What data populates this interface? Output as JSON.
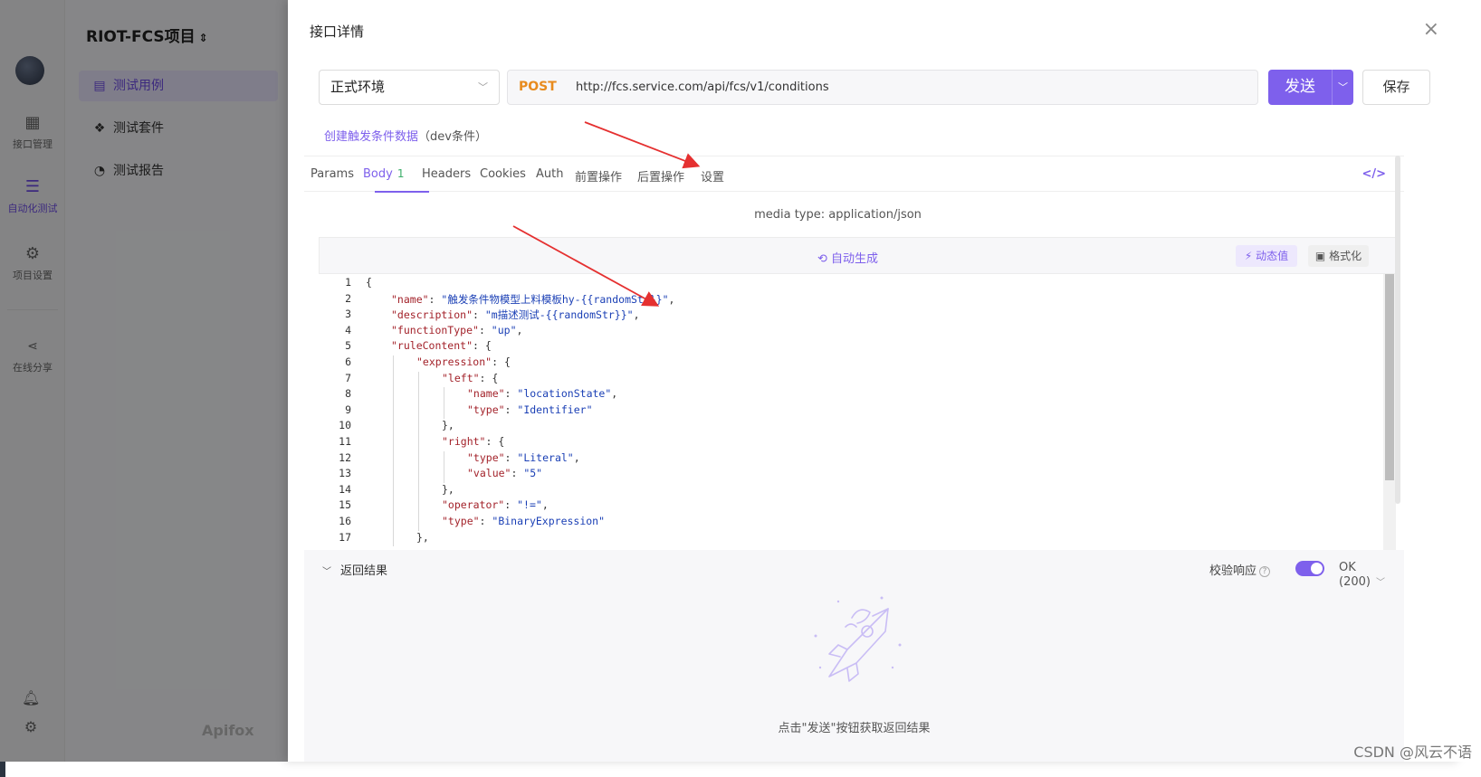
{
  "app": {
    "project_title": "RIOT-FCS项目",
    "rail": [
      {
        "label": "接口管理",
        "icon": "api-icon"
      },
      {
        "label": "自动化测试",
        "icon": "automation-icon"
      },
      {
        "label": "项目设置",
        "icon": "settings-icon"
      },
      {
        "label": "在线分享",
        "icon": "share-icon"
      }
    ],
    "menu": [
      {
        "label": "测试用例",
        "icon": "doc-icon"
      },
      {
        "label": "测试套件",
        "icon": "suite-icon"
      },
      {
        "label": "测试报告",
        "icon": "report-icon"
      }
    ],
    "brand": "Apifox"
  },
  "drawer": {
    "title": "接口详情",
    "close_glyph": "×",
    "environment": "正式环境",
    "method": "POST",
    "url": "http://fcs.service.com/api/fcs/v1/conditions",
    "send_label": "发送",
    "save_label": "保存",
    "api_name": "创建触发条件数据",
    "api_tag": "（dev条件）",
    "tabs": [
      {
        "label": "Params"
      },
      {
        "label": "Body",
        "badge": "1"
      },
      {
        "label": "Headers"
      },
      {
        "label": "Cookies"
      },
      {
        "label": "Auth"
      },
      {
        "label": "前置操作"
      },
      {
        "label": "后置操作"
      },
      {
        "label": "设置"
      }
    ],
    "code_icon": "</>",
    "media_type": "media type: application/json",
    "auto_generate": "自动生成",
    "dynamic_value": "动态值",
    "format": "格式化",
    "code_lines": [
      {
        "n": "1",
        "indent": 0,
        "parts": [
          [
            "p",
            "{"
          ]
        ]
      },
      {
        "n": "2",
        "indent": 1,
        "parts": [
          [
            "k",
            "\"name\""
          ],
          [
            "p",
            ": "
          ],
          [
            "s",
            "\"触发条件物模型上料模板hy-{{randomStr}}\""
          ],
          [
            "p",
            ","
          ]
        ]
      },
      {
        "n": "3",
        "indent": 1,
        "parts": [
          [
            "k",
            "\"description\""
          ],
          [
            "p",
            ": "
          ],
          [
            "s",
            "\"m描述测试-{{randomStr}}\""
          ],
          [
            "p",
            ","
          ]
        ]
      },
      {
        "n": "4",
        "indent": 1,
        "parts": [
          [
            "k",
            "\"functionType\""
          ],
          [
            "p",
            ": "
          ],
          [
            "s",
            "\"up\""
          ],
          [
            "p",
            ","
          ]
        ]
      },
      {
        "n": "5",
        "indent": 1,
        "parts": [
          [
            "k",
            "\"ruleContent\""
          ],
          [
            "p",
            ": {"
          ]
        ]
      },
      {
        "n": "6",
        "indent": 2,
        "parts": [
          [
            "k",
            "\"expression\""
          ],
          [
            "p",
            ": {"
          ]
        ]
      },
      {
        "n": "7",
        "indent": 3,
        "parts": [
          [
            "k",
            "\"left\""
          ],
          [
            "p",
            ": {"
          ]
        ]
      },
      {
        "n": "8",
        "indent": 4,
        "parts": [
          [
            "k",
            "\"name\""
          ],
          [
            "p",
            ": "
          ],
          [
            "s",
            "\"locationState\""
          ],
          [
            "p",
            ","
          ]
        ]
      },
      {
        "n": "9",
        "indent": 4,
        "parts": [
          [
            "k",
            "\"type\""
          ],
          [
            "p",
            ": "
          ],
          [
            "s",
            "\"Identifier\""
          ]
        ]
      },
      {
        "n": "10",
        "indent": 3,
        "parts": [
          [
            "p",
            "},"
          ]
        ]
      },
      {
        "n": "11",
        "indent": 3,
        "parts": [
          [
            "k",
            "\"right\""
          ],
          [
            "p",
            ": {"
          ]
        ]
      },
      {
        "n": "12",
        "indent": 4,
        "parts": [
          [
            "k",
            "\"type\""
          ],
          [
            "p",
            ": "
          ],
          [
            "s",
            "\"Literal\""
          ],
          [
            "p",
            ","
          ]
        ]
      },
      {
        "n": "13",
        "indent": 4,
        "parts": [
          [
            "k",
            "\"value\""
          ],
          [
            "p",
            ": "
          ],
          [
            "s",
            "\"5\""
          ]
        ]
      },
      {
        "n": "14",
        "indent": 3,
        "parts": [
          [
            "p",
            "},"
          ]
        ]
      },
      {
        "n": "15",
        "indent": 3,
        "parts": [
          [
            "k",
            "\"operator\""
          ],
          [
            "p",
            ": "
          ],
          [
            "s",
            "\"!=\""
          ],
          [
            "p",
            ","
          ]
        ]
      },
      {
        "n": "16",
        "indent": 3,
        "parts": [
          [
            "k",
            "\"type\""
          ],
          [
            "p",
            ": "
          ],
          [
            "s",
            "\"BinaryExpression\""
          ]
        ]
      },
      {
        "n": "17",
        "indent": 2,
        "parts": [
          [
            "p",
            "},"
          ]
        ]
      }
    ],
    "result": {
      "title": "返回结果",
      "verify_label": "校验响应",
      "verify_on": true,
      "status": "OK (200)",
      "empty_hint": "点击\"发送\"按钮获取返回结果"
    }
  },
  "watermark": "CSDN @风云不语",
  "colors": {
    "accent": "#7e60ec",
    "method_post": "#e88b1e",
    "json_key": "#a3222a",
    "json_string": "#1a3fb5",
    "annotation_arrow": "#e53030"
  }
}
